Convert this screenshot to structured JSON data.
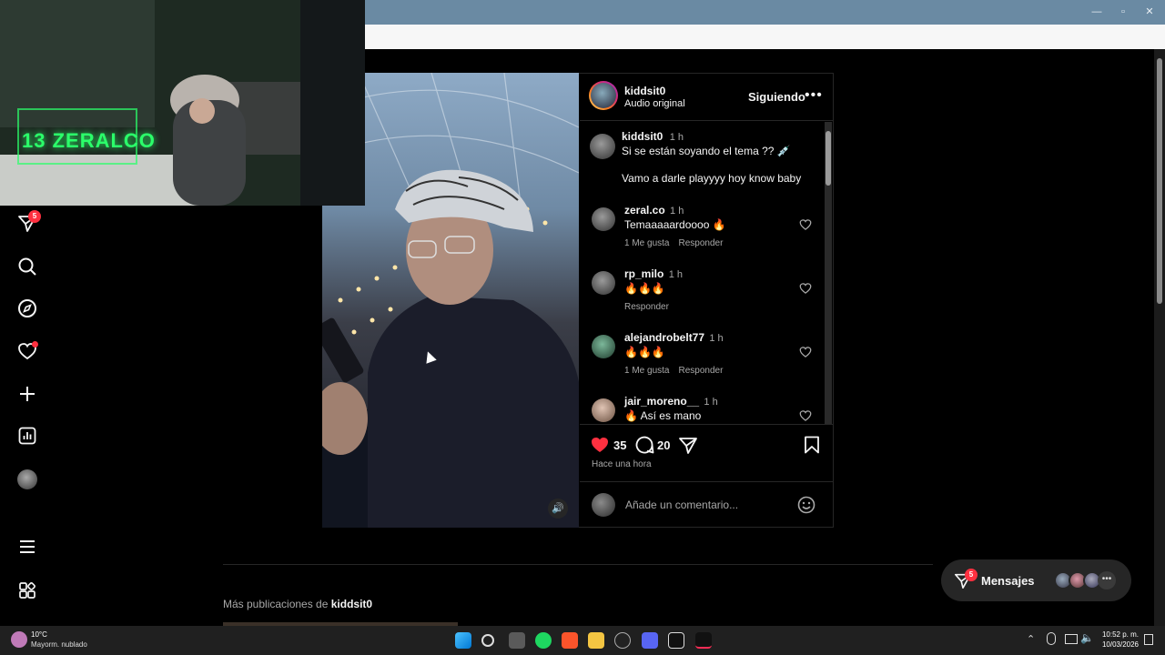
{
  "browser": {
    "url_fragment": "/"
  },
  "sidebar": {
    "notifications_badge": "5"
  },
  "post": {
    "author": "kiddsit0",
    "audio": "Audio original",
    "follow_label": "Siguiendo",
    "caption": {
      "user": "kiddsit0",
      "time": "1 h",
      "line1": "Si se están soyando el tema ?? 💉",
      "line2": "Vamo a darle playyyy hoy know baby"
    },
    "comments": [
      {
        "user": "zeral.co",
        "time": "1 h",
        "text": "Temaaaaardoooo 🔥",
        "likes": "1 Me gusta",
        "reply": "Responder"
      },
      {
        "user": "rp_milo",
        "time": "1 h",
        "text": "🔥🔥🔥",
        "likes": "",
        "reply": "Responder"
      },
      {
        "user": "alejandrobelt77",
        "time": "1 h",
        "text": "🔥🔥🔥",
        "likes": "1 Me gusta",
        "reply": "Responder"
      },
      {
        "user": "jair_moreno__",
        "time": "1 h",
        "text": "🔥 Así es mano",
        "likes": "",
        "reply": ""
      }
    ],
    "like_count": "35",
    "comment_count": "20",
    "timestamp": "Hace una hora",
    "comment_placeholder": "Añade un comentario..."
  },
  "more_posts": {
    "prefix": "Más publicaciones de",
    "user": "kiddsit0"
  },
  "messages": {
    "label": "Mensajes",
    "badge": "5"
  },
  "webcam": {
    "logo_text": "13 ZERALCO"
  },
  "taskbar": {
    "temperature": "10°C",
    "weather": "Mayorm. nublado",
    "time": "10:52 p. m.",
    "date": "10/03/2026"
  },
  "colors": {
    "like_red": "#ff3040",
    "taskbar_accent": "#6a2a9a",
    "neon_green": "#2bff6a"
  }
}
